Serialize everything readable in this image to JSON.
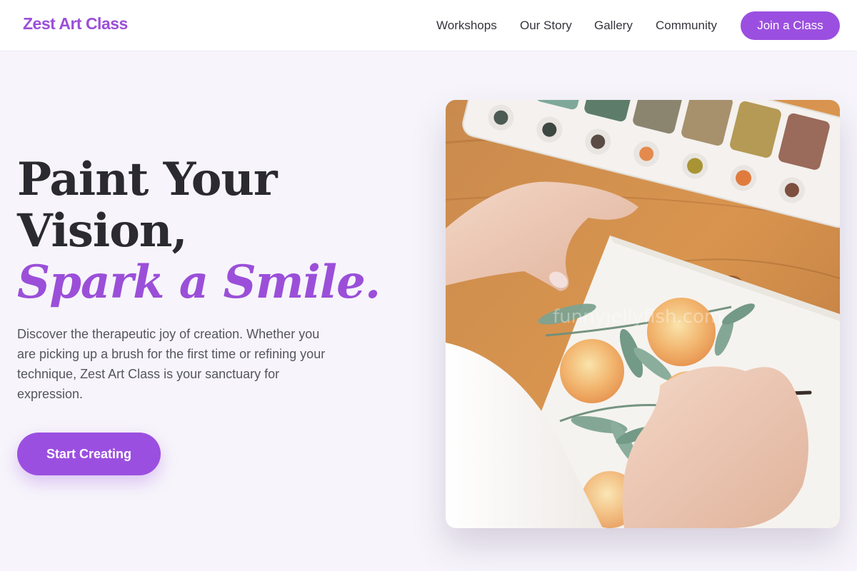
{
  "header": {
    "logo": "Zest Art Class",
    "nav": [
      {
        "label": "Workshops"
      },
      {
        "label": "Our Story"
      },
      {
        "label": "Gallery"
      },
      {
        "label": "Community"
      }
    ],
    "cta_label": "Join a Class"
  },
  "hero": {
    "headline_line1": "Paint Your",
    "headline_line2": "Vision,",
    "headline_accent": "Spark a Smile.",
    "description": "Discover the therapeutic joy of creation. Whether you are picking up a brush for the first time or refining your technique, Zest Art Class is your sanctuary for expression.",
    "cta_label": "Start Creating",
    "image": {
      "watermark": "funnyjellyfish.com"
    }
  },
  "colors": {
    "accent": "#9b4fd9",
    "background": "#f7f5fb",
    "text": "#2a2a30"
  }
}
